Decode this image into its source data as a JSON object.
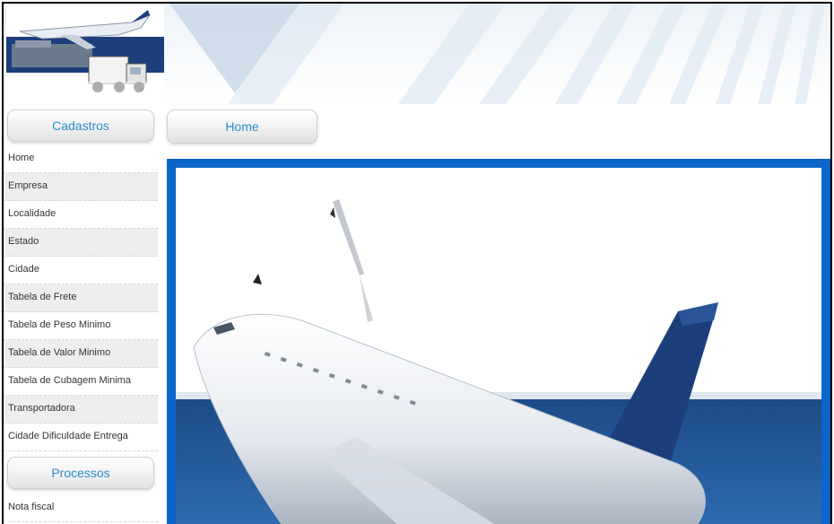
{
  "sidebar": {
    "cadastros_title": "Cadastros",
    "cadastros_items": [
      "Home",
      "Empresa",
      "Localidade",
      "Estado",
      "Cidade",
      "Tabela de Frete",
      "Tabela de Peso Minimo",
      "Tabela de Valor Minimo",
      "Tabela de Cubagem Minima",
      "Transportadora",
      "Cidade Dificuldade Entrega"
    ],
    "processos_title": "Processos",
    "processos_items": [
      "Nota fiscal"
    ]
  },
  "main": {
    "tab_label": "Home"
  },
  "colors": {
    "accent": "#2a8ec9",
    "content_border": "#0a66c8",
    "navy": "#1c3f7c"
  }
}
